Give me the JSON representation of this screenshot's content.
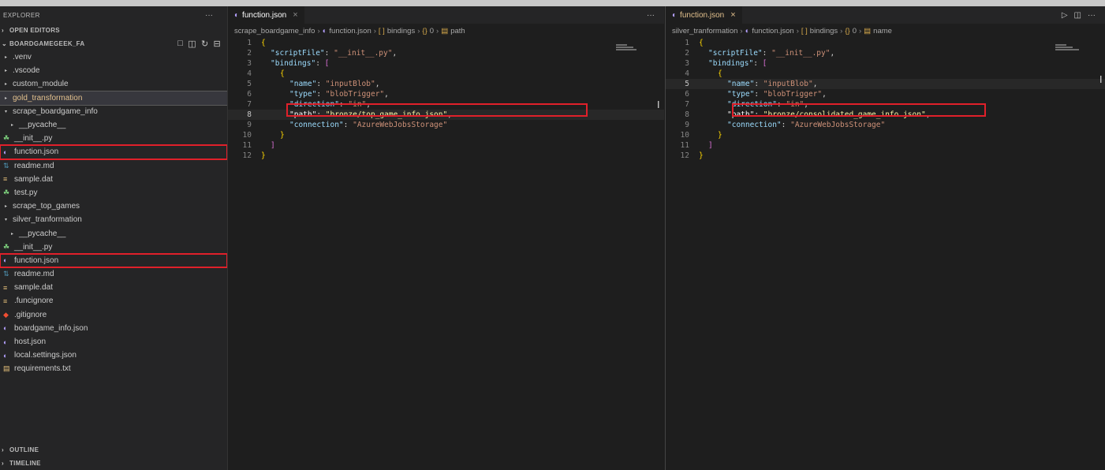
{
  "sidebar": {
    "title": "EXPLORER",
    "more": "···",
    "open_editors": "OPEN EDITORS",
    "project": "BOARDGAMEGEEK_FA",
    "items": [
      {
        "label": ".venv",
        "icon": "chevron-right-icon"
      },
      {
        "label": ".vscode",
        "icon": "chevron-right-icon"
      },
      {
        "label": "custom_module",
        "icon": "chevron-right-icon"
      },
      {
        "label": "gold_transformation",
        "icon": "chevron-right-icon"
      },
      {
        "label": "scrape_boardgame_info",
        "icon": "chevron-down-icon"
      },
      {
        "label": "__pycache__",
        "icon": "chevron-right-icon"
      },
      {
        "label": "__init__.py",
        "icon": "python-icon"
      },
      {
        "label": "function.json",
        "icon": "json-icon"
      },
      {
        "label": "readme.md",
        "icon": "markdown-icon"
      },
      {
        "label": "sample.dat",
        "icon": "text-file-icon"
      },
      {
        "label": "test.py",
        "icon": "python-icon"
      },
      {
        "label": "scrape_top_games",
        "icon": "chevron-right-icon"
      },
      {
        "label": "silver_tranformation",
        "icon": "chevron-down-icon"
      },
      {
        "label": "__pycache__",
        "icon": "chevron-right-icon"
      },
      {
        "label": "__init__.py",
        "icon": "python-icon"
      },
      {
        "label": "function.json",
        "icon": "json-icon"
      },
      {
        "label": "readme.md",
        "icon": "markdown-icon"
      },
      {
        "label": "sample.dat",
        "icon": "text-file-icon"
      },
      {
        "label": ".funcignore",
        "icon": "text-file-icon"
      },
      {
        "label": ".gitignore",
        "icon": "git-icon"
      },
      {
        "label": "boardgame_info.json",
        "icon": "json-icon"
      },
      {
        "label": "host.json",
        "icon": "json-icon"
      },
      {
        "label": "local.settings.json",
        "icon": "json-icon"
      },
      {
        "label": "requirements.txt",
        "icon": "text-file-icon"
      }
    ],
    "outline": "OUTLINE",
    "timeline": "TIMELINE"
  },
  "left_editor": {
    "tab_label": "function.json",
    "breadcrumb": [
      "scrape_boardgame_info",
      "function.json",
      "bindings",
      "0",
      "path"
    ],
    "current_line": "8",
    "lines": [
      {
        "n": "1",
        "text": "{"
      },
      {
        "n": "2",
        "text": "\"scriptFile\": \"__init__.py\","
      },
      {
        "n": "3",
        "text": "\"bindings\": ["
      },
      {
        "n": "4",
        "text": "{"
      },
      {
        "n": "5",
        "text": "\"name\": \"inputBlob\","
      },
      {
        "n": "6",
        "text": "\"type\": \"blobTrigger\","
      },
      {
        "n": "7",
        "text": "\"direction\": \"in\","
      },
      {
        "n": "8",
        "text": "\"path\": \"bronze/top_game_info.json\","
      },
      {
        "n": "9",
        "text": "\"connection\": \"AzureWebJobsStorage\""
      },
      {
        "n": "10",
        "text": "}"
      },
      {
        "n": "11",
        "text": "]"
      },
      {
        "n": "12",
        "text": "}"
      }
    ]
  },
  "right_editor": {
    "tab_label": "function.json",
    "breadcrumb": [
      "silver_tranformation",
      "function.json",
      "bindings",
      "0",
      "name"
    ],
    "current_line": "5",
    "lines": [
      {
        "n": "1",
        "text": "{"
      },
      {
        "n": "2",
        "text": "\"scriptFile\": \"__init__.py\","
      },
      {
        "n": "3",
        "text": "\"bindings\": ["
      },
      {
        "n": "4",
        "text": "{"
      },
      {
        "n": "5",
        "text": "\"name\": \"inputBlob\","
      },
      {
        "n": "6",
        "text": "\"type\": \"blobTrigger\","
      },
      {
        "n": "7",
        "text": "\"direction\": \"in\","
      },
      {
        "n": "8",
        "text": "\"path\": \"bronze/consolidated_game_info.json\","
      },
      {
        "n": "9",
        "text": "\"connection\": \"AzureWebJobsStorage\""
      },
      {
        "n": "10",
        "text": "}"
      },
      {
        "n": "11",
        "text": "]"
      },
      {
        "n": "12",
        "text": "}"
      }
    ]
  },
  "colors": {
    "highlight_box": "#e0202a",
    "selected_folder": "#e2c08d",
    "json_icon": "#b4a0ff"
  }
}
